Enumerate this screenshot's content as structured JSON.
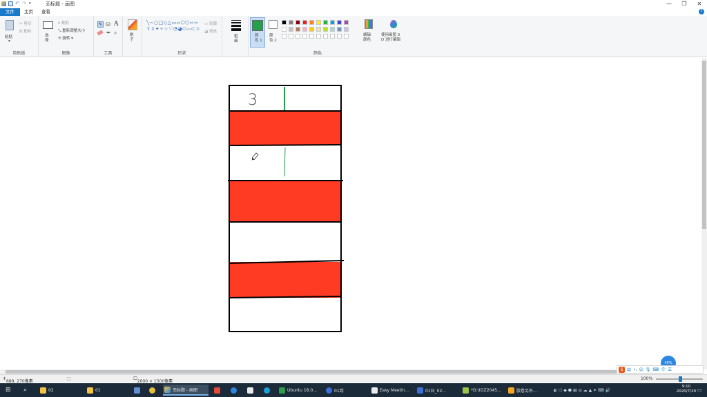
{
  "window": {
    "title": "无标题 - 画图",
    "minimize": "—",
    "restore": "❐",
    "close": "✕"
  },
  "tabs": [
    "文件",
    "主页",
    "查看"
  ],
  "ribbon": {
    "clipboard": {
      "paste": "粘贴",
      "cut": "剪切",
      "copy": "复制",
      "label": "剪贴板"
    },
    "image": {
      "select": "选\n择",
      "crop": "裁剪",
      "resize": "重新调整大小",
      "rotate": "旋转",
      "label": "图像"
    },
    "tools": {
      "label": "工具"
    },
    "brushes": {
      "label": "刷\n子"
    },
    "shapes": {
      "outline": "轮廓",
      "fill": "填充",
      "label": "形状"
    },
    "size": {
      "label": "粗\n细"
    },
    "colors": {
      "color1": "颜\n色 1",
      "color2": "颜\n色 2",
      "edit": "编辑\n颜色",
      "paint3d": "使用画图 3\nD 进行编辑",
      "label": "颜色",
      "color1_value": "#22a04b",
      "color2_value": "#ffffff",
      "palette": [
        "#000000",
        "#7f7f7f",
        "#880015",
        "#ed1c24",
        "#ff7f27",
        "#fff200",
        "#22b14c",
        "#00a2e8",
        "#3f48cc",
        "#a349a4",
        "#ffffff",
        "#c3c3c3",
        "#b97a57",
        "#ffaec9",
        "#ffc90e",
        "#efe4b0",
        "#b5e61d",
        "#99d9ea",
        "#7092be",
        "#c8bfe7"
      ]
    }
  },
  "drawing": {
    "handwritten_number": "3",
    "stripe_color": "#ff3b24",
    "outline_color": "#000000",
    "green_line_color": "#22a04b"
  },
  "status": {
    "cursor_position": "689, 270像素",
    "canvas_size": "2000 × 1500像素",
    "zoom": "100%"
  },
  "ime": {
    "logo": "S",
    "mode": "中"
  },
  "float_ball": "45%",
  "taskbar": {
    "items": [
      "02",
      "01",
      "无标题 - 画图",
      "Ubuntu 18.0...",
      "01到",
      "Easy Meetin...",
      "01日_02...",
      "*D:\\(GZ2045...",
      "胶卷另外..."
    ],
    "clock_time": "9:10",
    "clock_date": "2020/7/29"
  }
}
